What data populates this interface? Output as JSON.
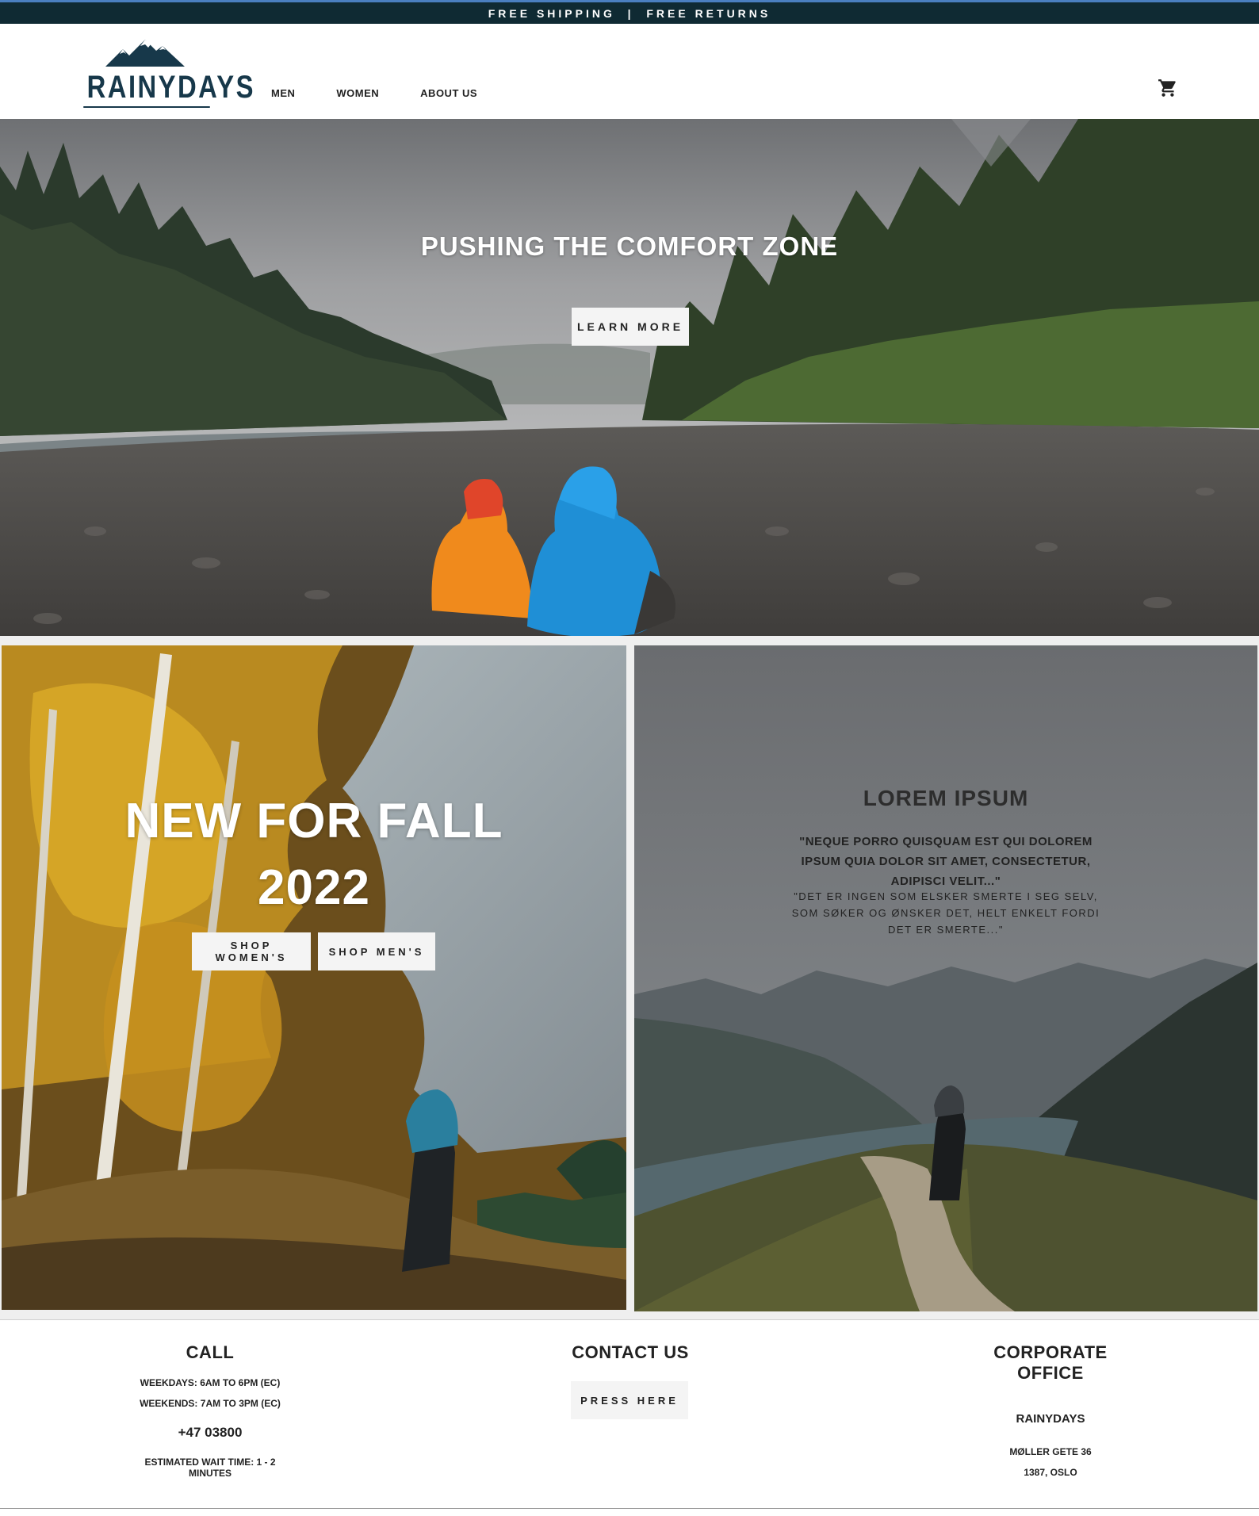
{
  "topbar": {
    "text": "FREE SHIPPING  |  FREE RETURNS"
  },
  "header": {
    "logo_text": "RAINYDAYS",
    "nav": [
      {
        "label": "MEN"
      },
      {
        "label": "WOMEN"
      },
      {
        "label": "ABOUT US"
      }
    ],
    "cart_icon": "shopping-cart-icon"
  },
  "hero": {
    "title": "PUSHING THE COMFORT ZONE",
    "button_label": "LEARN MORE"
  },
  "fall": {
    "title_line1": "NEW FOR FALL",
    "title_line2": "2022",
    "button_women": "SHOP WOMEN'S",
    "button_men": "SHOP MEN'S"
  },
  "lorem": {
    "title": "LOREM IPSUM",
    "quote": "\"NEQUE PORRO QUISQUAM EST QUI DOLOREM IPSUM QUIA DOLOR SIT AMET, CONSECTETUR, ADIPISCI VELIT...\"",
    "quote_translation": "\"DET ER INGEN SOM ELSKER SMERTE I SEG SELV, SOM SØKER OG ØNSKER DET, HELT ENKELT FORDI DET ER SMERTE...\""
  },
  "footer": {
    "call": {
      "title": "CALL",
      "weekdays": "WEEKDAYS: 6AM TO 6PM (EC)",
      "weekends": "WEEKENDS: 7AM TO 3PM (EC)",
      "phone": "+47 03800",
      "wait_time": "ESTIMATED WAIT TIME: 1 - 2 MINUTES"
    },
    "contact": {
      "title": "CONTACT US",
      "button_label": "PRESS HERE"
    },
    "office": {
      "title": "CORPORATE OFFICE",
      "company": "RAINYDAYS",
      "street": "MØLLER GETE 36",
      "city": "1387, OSLO"
    }
  },
  "colors": {
    "topbar_bg": "#0f2a33",
    "topbar_accent": "#4a7fc0",
    "brand": "#17384a",
    "button_bg": "#f4f4f4"
  }
}
